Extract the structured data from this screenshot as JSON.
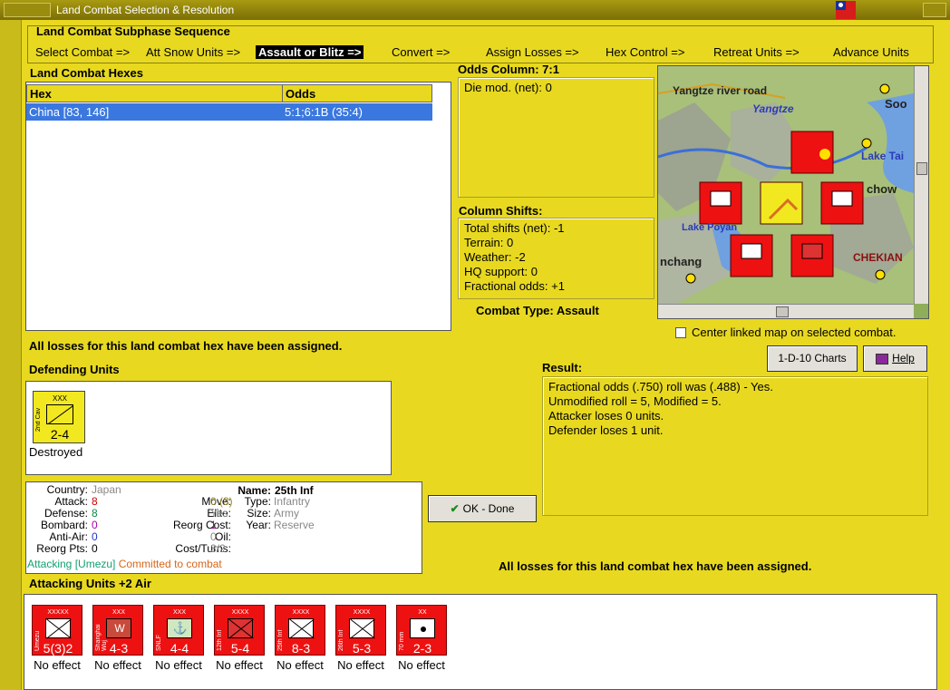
{
  "window": {
    "title": "Land Combat Selection & Resolution"
  },
  "sequence": {
    "title": "Land Combat Subphase Sequence",
    "steps": [
      "Select Combat =>",
      "Att Snow Units =>",
      "Assault or Blitz =>",
      "Convert =>",
      "Assign Losses =>",
      "Hex Control =>",
      "Retreat Units =>",
      "Advance Units"
    ]
  },
  "hexes": {
    "title": "Land Combat Hexes",
    "columns": [
      "Hex",
      "Odds"
    ],
    "rows": [
      {
        "hex": "China [83, 146]",
        "odds": "5:1;6:1B (35:4)"
      }
    ]
  },
  "odds": {
    "title": "Odds Column: 7:1",
    "die_mod": "Die mod. (net): 0"
  },
  "shifts": {
    "title": "Column Shifts:",
    "lines": [
      "Total shifts (net): -1",
      "Terrain: 0",
      "Weather: -2",
      "HQ support: 0",
      "Fractional odds: +1"
    ]
  },
  "combat_type": "Combat Type:  Assault",
  "map": {
    "labels": [
      "Yangtze river road",
      "Yangtze",
      "Soo",
      "Lake Tai",
      "chow",
      "Lake Poyan",
      "nchang",
      "CHEKIAN"
    ],
    "center_label": "Center linked map on selected combat."
  },
  "losses_note": "All losses for this land combat hex have been assigned.",
  "defending": {
    "title": "Defending Units",
    "units": [
      {
        "size": "XXX",
        "name": "2nd Cav",
        "strength": "2-4",
        "status": "Destroyed"
      }
    ]
  },
  "buttons": {
    "charts": "1-D-10 Charts",
    "help": "Help",
    "ok": "OK - Done"
  },
  "result": {
    "title": "Result:",
    "lines": [
      "Fractional odds (.750) roll was (.488)  - Yes.",
      "Unmodified roll = 5, Modified = 5.",
      "Attacker loses 0 units.",
      "Defender loses 1 unit."
    ]
  },
  "unit_info": {
    "labels": {
      "country": "Country:",
      "attack": "Attack:",
      "defense": "Defense:",
      "bombard": "Bombard:",
      "anti_air": "Anti-Air:",
      "reorg_pts": "Reorg Pts:",
      "name": "Name:",
      "move": "Move:",
      "type": "Type:",
      "elite": "Elite:",
      "size": "Size:",
      "reorg_cost": "Reorg Cost:",
      "year": "Year:",
      "oil": "Oil:",
      "cost_turns": "Cost/Turns:"
    },
    "values": {
      "country": "Japan",
      "attack": "8",
      "defense": "8",
      "bombard": "0",
      "anti_air": "0",
      "reorg_pts": "0",
      "name": "25th Inf",
      "move": "0 (3)",
      "type": "Infantry",
      "elite": "Yes",
      "size": "Army",
      "reorg_cost": "1",
      "year": "Reserve",
      "oil": "0",
      "cost_turns": "3/2"
    },
    "attacking": "Attacking [Umezu]",
    "committed": "Committed to combat"
  },
  "losses_note_bottom": "All losses for this land combat hex have been assigned.",
  "attacking": {
    "title": "Attacking Units +2 Air",
    "units": [
      {
        "size": "XXXXX",
        "name": "Umezu",
        "strength": "5(3)2",
        "effect": "No effect"
      },
      {
        "size": "XXX",
        "name": "Shanghai Wuj",
        "strength": "4-3",
        "effect": "No effect"
      },
      {
        "size": "XXX",
        "name": "SNLF",
        "strength": "4-4",
        "effect": "No effect"
      },
      {
        "size": "XXXX",
        "name": "12th Inf",
        "strength": "5-4",
        "effect": "No effect"
      },
      {
        "size": "XXXX",
        "name": "25th Inf",
        "strength": "8-3",
        "effect": "No effect"
      },
      {
        "size": "XXXX",
        "name": "26th Inf",
        "strength": "5-3",
        "effect": "No effect"
      },
      {
        "size": "XX",
        "name": "70 mm",
        "strength": "2-3",
        "effect": "No effect"
      }
    ]
  },
  "colors": {
    "panel_yellow": "#e8d920",
    "unit_red": "#ee1111",
    "selected_row": "#3a78e0"
  }
}
